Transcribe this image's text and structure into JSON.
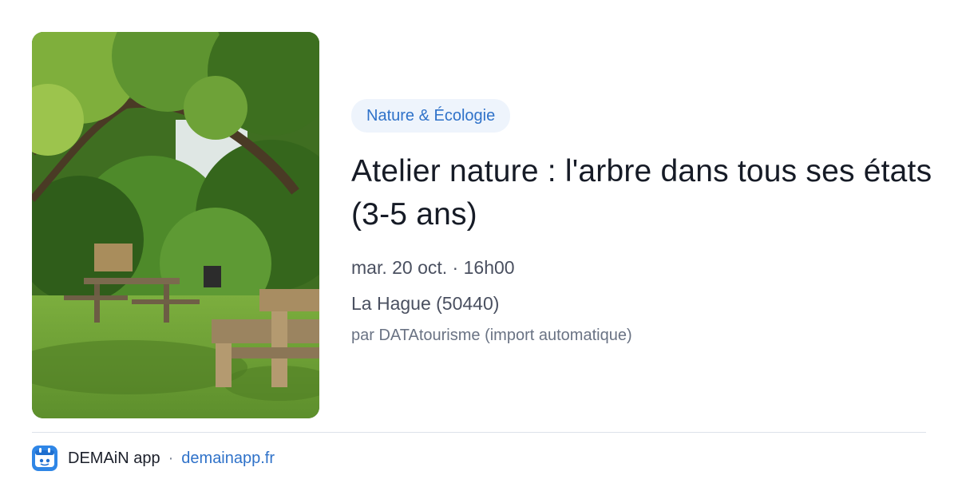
{
  "card": {
    "category": "Nature & Écologie",
    "title": "Atelier nature : l'arbre dans tous ses états (3-5 ans)",
    "date_time": "mar. 20 oct. · 16h00",
    "location": "La Hague (50440)",
    "source": "par DATAtourisme (import automatique)",
    "image_icon": "park-picnic-photo"
  },
  "footer": {
    "app_name": "DEMAiN app",
    "separator": "·",
    "site": "demainapp.fr",
    "app_icon": "demain-app-icon"
  },
  "colors": {
    "accent": "#2f72c9",
    "badge_bg": "#eef4fc",
    "divider": "#dde2ea",
    "text": "#161b26",
    "muted": "#6a7384"
  }
}
